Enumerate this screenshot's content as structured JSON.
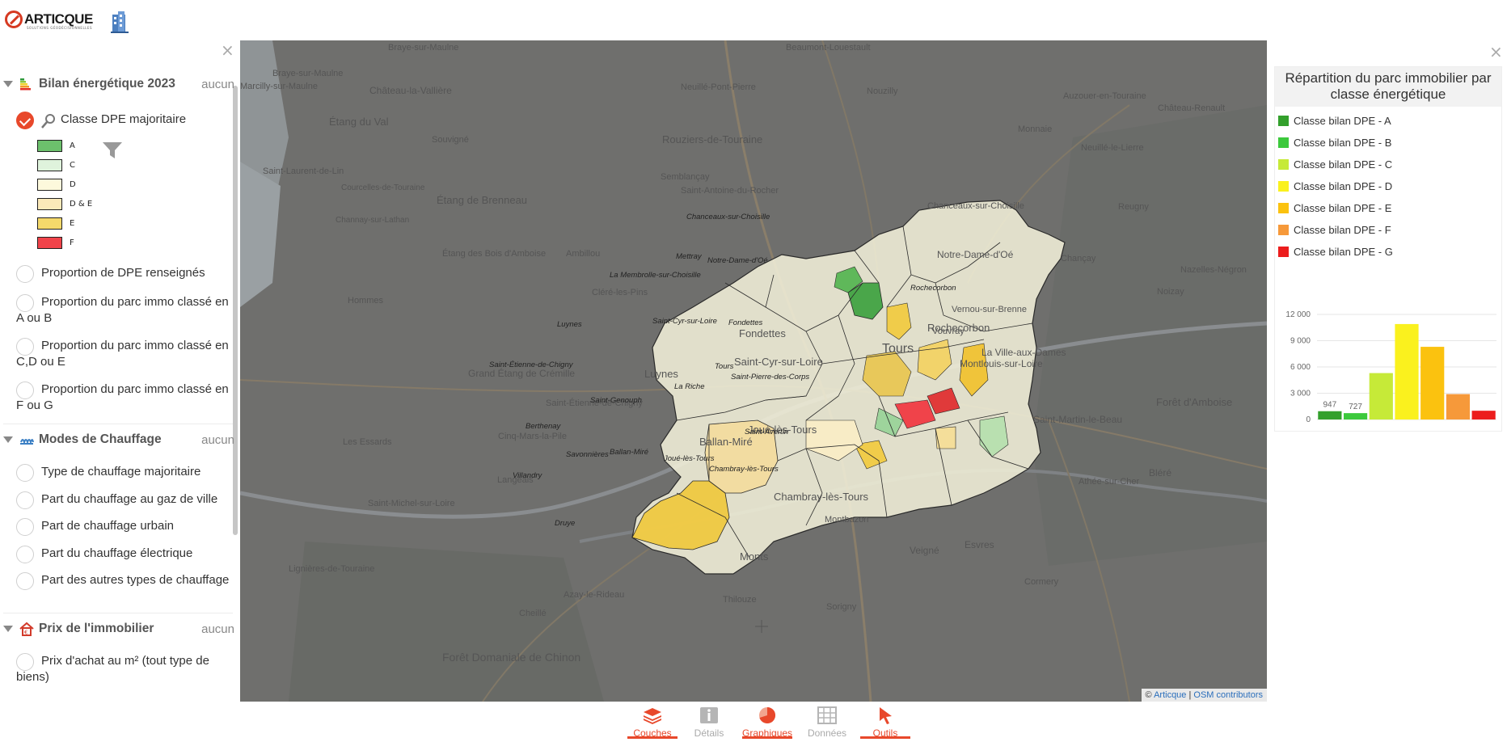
{
  "app": {
    "logo_text": "ARTICQUE",
    "logo_sub": "SOLUTIONS GÉODÉCISIONNELLES"
  },
  "left_panel": {
    "close_label": "×",
    "groups": [
      {
        "title": "Bilan énergétique 2023",
        "aucun": "aucun",
        "layers": [
          {
            "label": "Classe DPE majoritaire",
            "active": true,
            "legend": [
              {
                "label": "A",
                "color": "#6cc06c"
              },
              {
                "label": "C",
                "color": "#dff3dc"
              },
              {
                "label": "D",
                "color": "#fdf9dc"
              },
              {
                "label": "D & E",
                "color": "#fbe9b9"
              },
              {
                "label": "E",
                "color": "#f5d96b"
              },
              {
                "label": "F",
                "color": "#f0434a"
              }
            ]
          },
          {
            "label": "Proportion de DPE renseignés"
          },
          {
            "label": "Proportion du parc immo classé en A ou B"
          },
          {
            "label": "Proportion du parc immo classé en C,D ou E"
          },
          {
            "label": "Proportion du parc immo classé en F ou G"
          }
        ]
      },
      {
        "title": "Modes de Chauffage",
        "aucun": "aucun",
        "layers": [
          {
            "label": "Type de chauffage majoritaire"
          },
          {
            "label": "Part du chauffage au gaz de ville"
          },
          {
            "label": "Part de chauffage urbain"
          },
          {
            "label": "Part du chauffage électrique"
          },
          {
            "label": "Part des autres types de chauffage"
          }
        ]
      },
      {
        "title": "Prix de l'immobilier",
        "aucun": "aucun",
        "layers": [
          {
            "label": "Prix d'achat au m² (tout type de biens)"
          }
        ]
      }
    ]
  },
  "map": {
    "background_places": [
      "Braye-sur-Maulne",
      "Marcilly-sur-Maulne",
      "Château-la-Vallière",
      "Étang du Val",
      "Souvigné",
      "Saint-Laurent-de-Lin",
      "Courcelles-de-Touraine",
      "Channay-sur-Lathan",
      "Étang de Brenneau",
      "Semblançay",
      "Saint-Antoine-du-Rocher",
      "Neuillé-Pont-Pierre",
      "Beaumont-Louestault",
      "Rouziers-de-Touraine",
      "Étang des Bois d'Amboise",
      "Ambillou",
      "Cléré-les-Pins",
      "Hommes",
      "Saint-Michel-sur-Loire",
      "Langeais",
      "Cinq-Mars-la-Pile",
      "Les Essards",
      "Grand Étang de Crémille",
      "Saint-Étienne-de-Chigny",
      "Lignières-de-Touraine",
      "Ballan-Miré",
      "Joué-lès-Tours",
      "Chambray-lès-Tours",
      "Monts",
      "Montbazon",
      "Veigné",
      "Esvres",
      "Azay-le-Rideau",
      "Cheillé",
      "Thilouze",
      "Sorigny",
      "Cormery",
      "Forêt Domaniale de Chinon",
      "Rochecorbon",
      "Vernou-sur-Brenne",
      "Vouvray",
      "Montlouis-sur-Loire",
      "La Ville-aux-Dames",
      "Forêt d'Amboise",
      "Saint-Martin-le-Beau",
      "Athée-sur-Cher",
      "Bléré",
      "Reugny",
      "Chançay",
      "Noizay",
      "Nazelles-Négron",
      "Neuillé-le-Lierre",
      "Monnaie",
      "Nouzilly",
      "Auzouer-en-Touraine",
      "Château-Renault",
      "Chanceaux-sur-Choisille",
      "Notre-Dame-d'Oé",
      "Saint-Cyr-sur-Loire",
      "Fondettes",
      "Luynes",
      "Tours"
    ],
    "communes": [
      "Chanceaux-sur-Choisille",
      "Mettray",
      "Notre-Dame-d'Oé",
      "La Membrolle-sur-Choisille",
      "Rochecorbon",
      "Luynes",
      "Fondettes",
      "Saint-Cyr-sur-Loire",
      "Tours",
      "Saint-Étienne-de-Chigny",
      "Saint-Pierre-des-Corps",
      "La Riche",
      "Saint-Genouph",
      "Berthenay",
      "Savonnières",
      "Ballan-Miré",
      "Joué-lès-Tours",
      "Saint-Avertin",
      "Villandry",
      "Chambray-lès-Tours",
      "Druye"
    ],
    "attribution": {
      "prefix": "©",
      "articque": "Articque",
      "separator": "|",
      "osm": "OSM contributors"
    }
  },
  "right_panel": {
    "close_label": "×",
    "chart_title": "Répartition du parc immobilier par classe énergétique",
    "chart_data": {
      "type": "bar",
      "title": "Répartition du parc immobilier par classe énergétique",
      "categories": [
        "Classe bilan DPE - A",
        "Classe bilan DPE - B",
        "Classe bilan DPE - C",
        "Classe bilan DPE - D",
        "Classe bilan DPE - E",
        "Classe bilan DPE - F",
        "Classe bilan DPE - G"
      ],
      "values": [
        947,
        727,
        5300,
        10900,
        8300,
        2900,
        1000
      ],
      "data_labels": [
        "947",
        "727",
        "",
        "",
        "",
        "",
        ""
      ],
      "colors": [
        "#33a02c",
        "#3cc93c",
        "#c6ea38",
        "#faf11e",
        "#fbc20f",
        "#f6993a",
        "#ec1d1d"
      ],
      "yticks": [
        "0",
        "3 000",
        "6 000",
        "9 000",
        "12 000"
      ],
      "ylim": [
        0,
        12000
      ],
      "grid": true,
      "legend": "top"
    }
  },
  "toolbar": {
    "items": [
      {
        "label": "Couches",
        "state": "on",
        "icon": "layers-icon"
      },
      {
        "label": "Détails",
        "state": "off",
        "icon": "info-icon"
      },
      {
        "label": "Graphiques",
        "state": "on",
        "icon": "pie-chart-icon"
      },
      {
        "label": "Données",
        "state": "off",
        "icon": "table-icon"
      },
      {
        "label": "Outils",
        "state": "on",
        "icon": "cursor-icon"
      }
    ]
  }
}
